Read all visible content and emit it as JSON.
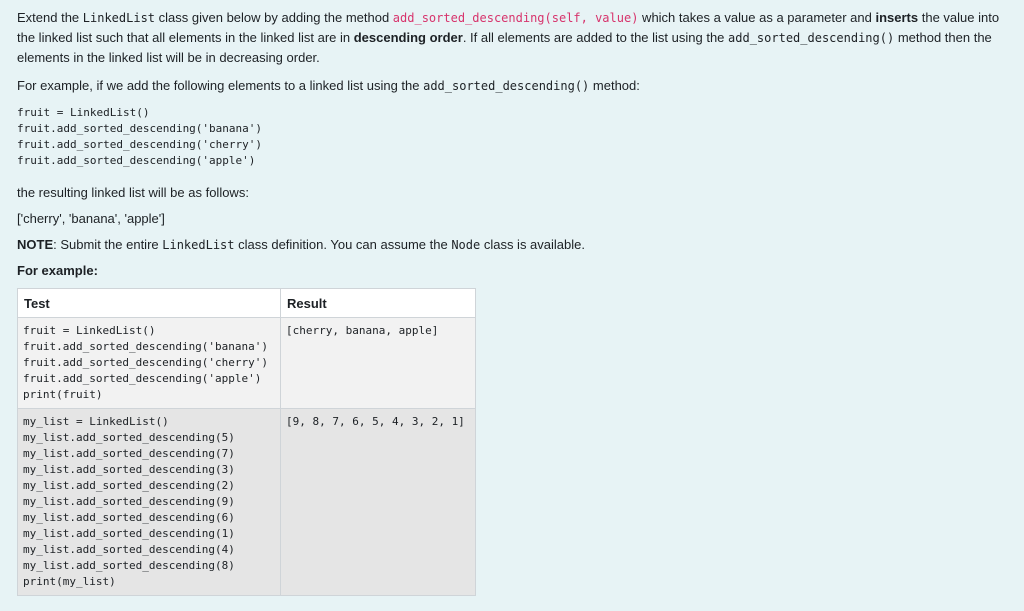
{
  "question": {
    "p1": {
      "t1": "Extend the ",
      "c1": "LinkedList",
      "t2": " class given below by adding the method ",
      "c2": "add_sorted_descending(self, value)",
      "t3": " which takes a value as a parameter and ",
      "b1": "inserts",
      "t4": " the value into the linked list such that all elements in the linked list are in ",
      "b2": "descending order",
      "t5": ".  If all elements are added to the list using the ",
      "c3": "add_sorted_descending()",
      "t6": " method then the elements in the linked list will be in decreasing order."
    },
    "p2": {
      "t1": "For example, if we add the following elements to a linked list using the ",
      "c1": "add_sorted_descending()",
      "t2": " method:"
    },
    "code_example": "fruit = LinkedList()\nfruit.add_sorted_descending('banana')\nfruit.add_sorted_descending('cherry')\nfruit.add_sorted_descending('apple')",
    "p3": "the resulting linked list will be as follows:",
    "p4": "['cherry', 'banana', 'apple']",
    "note": {
      "label": "NOTE",
      "t1": ": Submit the entire ",
      "c1": "LinkedList",
      "t2": " class definition. You can assume the ",
      "c2": "Node",
      "t3": " class is available."
    },
    "for_example": "For example:"
  },
  "table": {
    "headers": [
      "Test",
      "Result"
    ],
    "rows": [
      {
        "test": "fruit = LinkedList()\nfruit.add_sorted_descending('banana')\nfruit.add_sorted_descending('cherry')\nfruit.add_sorted_descending('apple')\nprint(fruit)",
        "result": "[cherry, banana, apple]"
      },
      {
        "test": "my_list = LinkedList()\nmy_list.add_sorted_descending(5)\nmy_list.add_sorted_descending(7)\nmy_list.add_sorted_descending(3)\nmy_list.add_sorted_descending(2)\nmy_list.add_sorted_descending(9)\nmy_list.add_sorted_descending(6)\nmy_list.add_sorted_descending(1)\nmy_list.add_sorted_descending(4)\nmy_list.add_sorted_descending(8)\nprint(my_list)",
        "result": "[9, 8, 7, 6, 5, 4, 3, 2, 1]"
      }
    ]
  }
}
